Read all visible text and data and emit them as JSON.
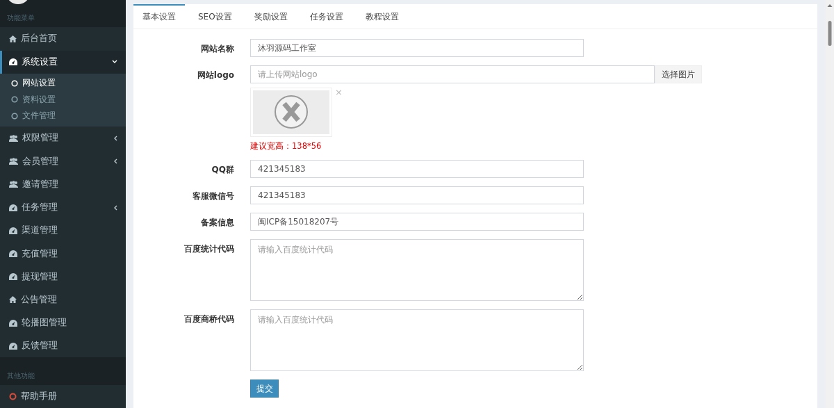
{
  "sidebar": {
    "sections": [
      {
        "header": "功能菜单",
        "items": [
          {
            "label": "后台首页",
            "kind": "home",
            "selected": false
          },
          {
            "label": "系统设置",
            "kind": "gauge",
            "selected": true,
            "expanded": true,
            "children": [
              {
                "label": "网站设置",
                "selected": true
              },
              {
                "label": "资料设置",
                "selected": false
              },
              {
                "label": "文件管理",
                "selected": false
              }
            ]
          },
          {
            "label": "权限管理",
            "kind": "users",
            "selected": false,
            "expanded": false
          },
          {
            "label": "会员管理",
            "kind": "users",
            "selected": false,
            "expanded": false
          },
          {
            "label": "邀请管理",
            "kind": "users",
            "selected": false
          },
          {
            "label": "任务管理",
            "kind": "gauge",
            "selected": false,
            "expanded": false
          },
          {
            "label": "渠道管理",
            "kind": "gauge",
            "selected": false
          },
          {
            "label": "充值管理",
            "kind": "gauge",
            "selected": false
          },
          {
            "label": "提现管理",
            "kind": "gauge",
            "selected": false
          },
          {
            "label": "公告管理",
            "kind": "home",
            "selected": false
          },
          {
            "label": "轮播图管理",
            "kind": "gauge",
            "selected": false
          },
          {
            "label": "反馈管理",
            "kind": "gauge",
            "selected": false
          }
        ]
      },
      {
        "header": "其他功能",
        "items": [
          {
            "label": "帮助手册",
            "kind": "help",
            "selected": false
          }
        ]
      }
    ]
  },
  "tabs": [
    {
      "label": "基本设置",
      "selected": true
    },
    {
      "label": "SEO设置",
      "selected": false
    },
    {
      "label": "奖励设置",
      "selected": false
    },
    {
      "label": "任务设置",
      "selected": false
    },
    {
      "label": "教程设置",
      "selected": false
    }
  ],
  "form": {
    "fields": [
      {
        "kind": "text",
        "label": "网站名称",
        "value": "沐羽源码工作室"
      },
      {
        "kind": "upload",
        "label": "网站logo",
        "placeholder": "请上传网站logo",
        "button": "选择图片",
        "hint": "建议宽高：138*56",
        "remove": "×"
      },
      {
        "kind": "text",
        "label": "QQ群",
        "value": "421345183"
      },
      {
        "kind": "text",
        "label": "客服微信号",
        "value": "421345183"
      },
      {
        "kind": "text",
        "label": "备案信息",
        "value": "闽ICP备15018207号"
      },
      {
        "kind": "textarea",
        "label": "百度统计代码",
        "placeholder": "请输入百度统计代码"
      },
      {
        "kind": "textarea",
        "label": "百度商桥代码",
        "placeholder": "请输入百度统计代码"
      }
    ],
    "submit": "提交"
  }
}
